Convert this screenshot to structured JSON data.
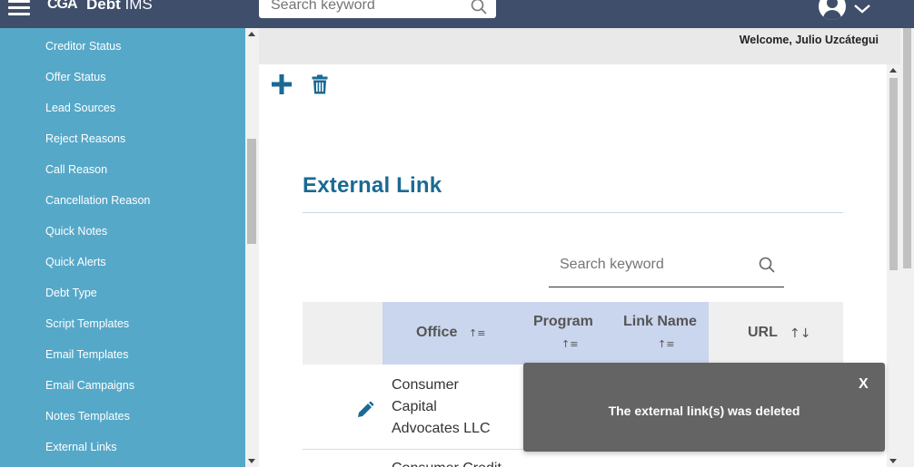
{
  "header": {
    "logo_text": "CGA",
    "app_title_bold": "Debt",
    "app_title_rest": "IMS",
    "search_placeholder": "Search keyword"
  },
  "sidebar": {
    "items": [
      {
        "label": "Creditor Status"
      },
      {
        "label": "Offer Status"
      },
      {
        "label": "Lead Sources"
      },
      {
        "label": "Reject Reasons"
      },
      {
        "label": "Call Reason"
      },
      {
        "label": "Cancellation Reason"
      },
      {
        "label": "Quick Notes"
      },
      {
        "label": "Quick Alerts"
      },
      {
        "label": "Debt Type"
      },
      {
        "label": "Script Templates"
      },
      {
        "label": "Email Templates"
      },
      {
        "label": "Email Campaigns"
      },
      {
        "label": "Notes Templates"
      },
      {
        "label": "External Links"
      }
    ]
  },
  "main": {
    "welcome": "Welcome, Julio Uzcátegui",
    "title": "External Link",
    "search_placeholder": "Search keyword",
    "columns": {
      "office": "Office",
      "program": "Program",
      "link_name": "Link Name",
      "url": "URL"
    },
    "rows": [
      {
        "office_lines": [
          "Consumer",
          "Capital",
          "Advocates LLC"
        ]
      },
      {
        "office_lines": [
          "Consumer Credit"
        ]
      }
    ]
  },
  "toast": {
    "close_label": "X",
    "message": "The external link(s) was deleted"
  },
  "colors": {
    "topbar": "#3f4e6b",
    "sidebar": "#56a8c8",
    "title": "#1a6a94",
    "header_highlight": "#cad6ed",
    "toast": "#646464"
  }
}
